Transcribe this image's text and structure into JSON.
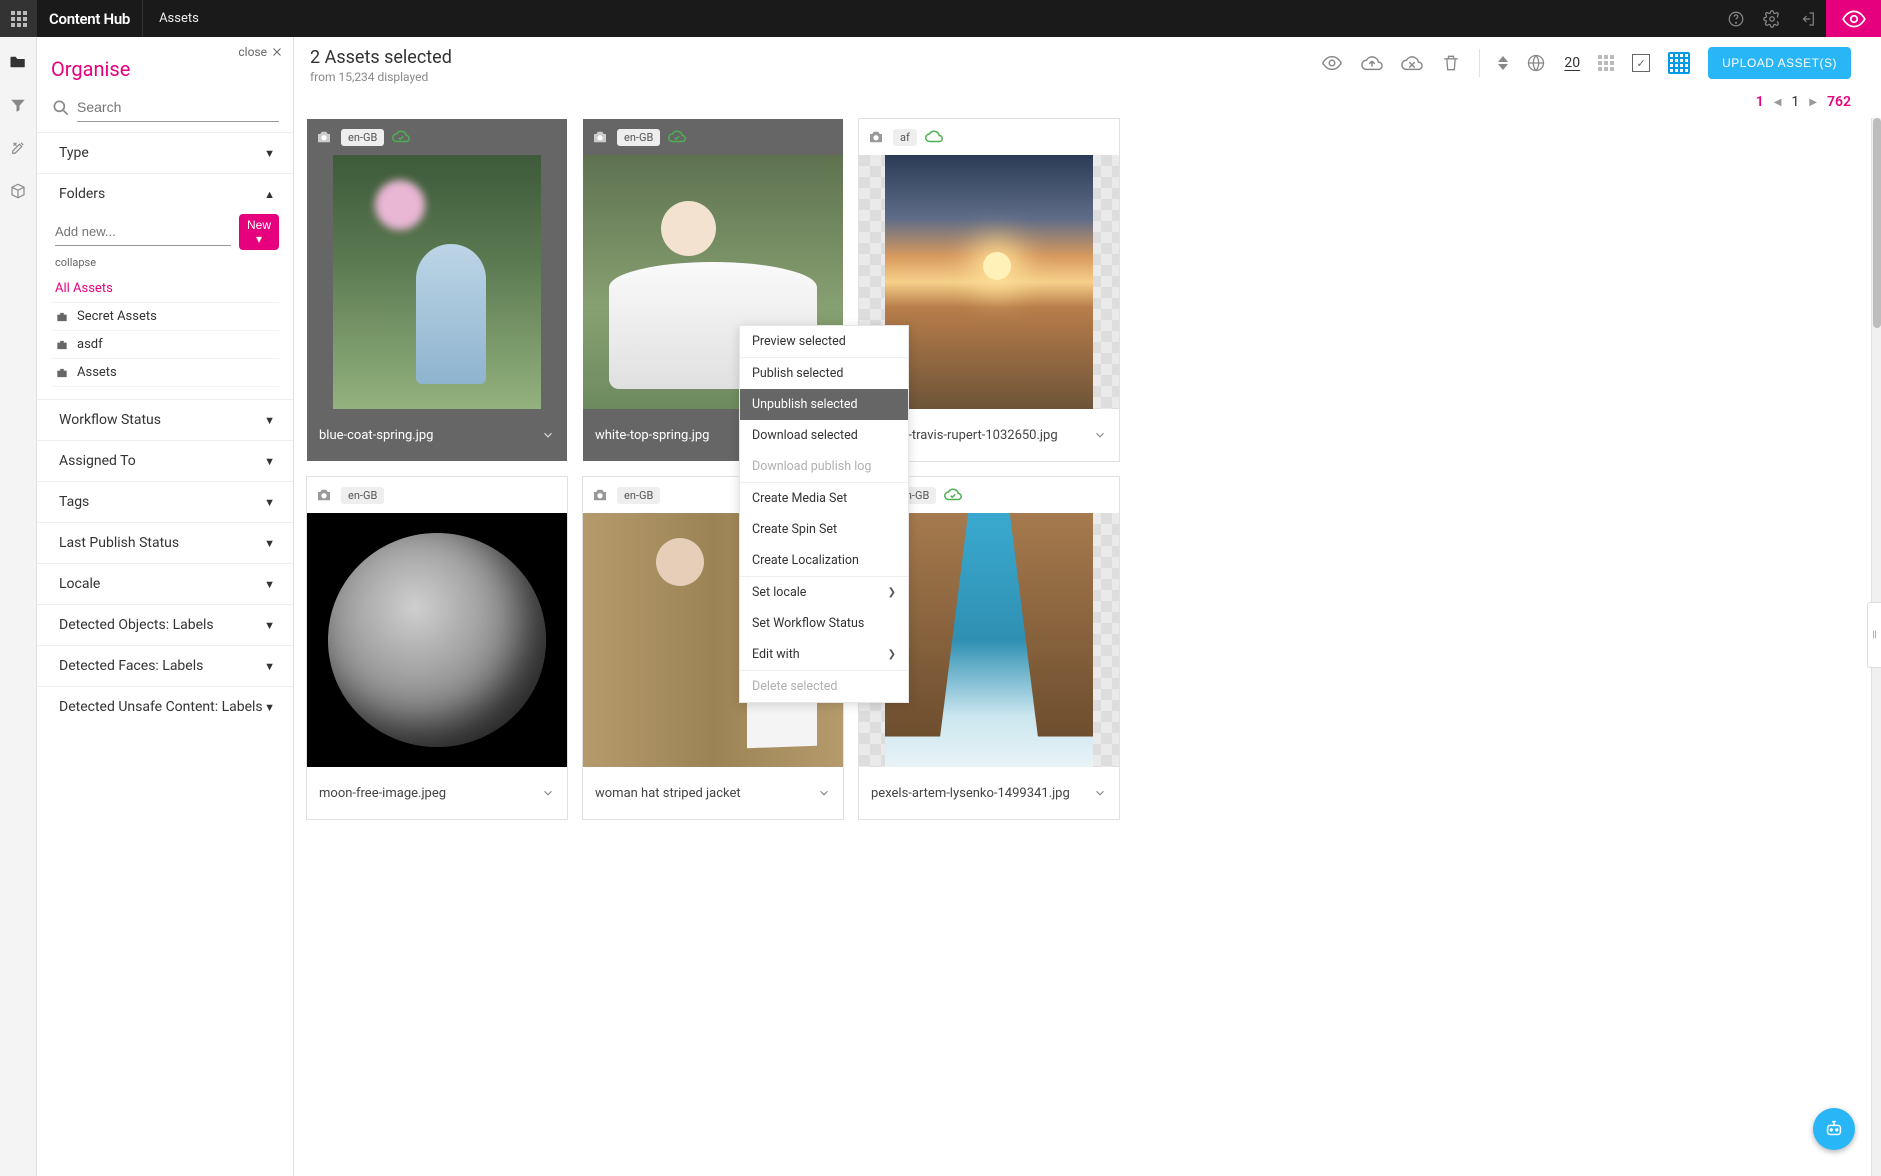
{
  "brand": "Content Hub",
  "top_nav": {
    "assets": "Assets"
  },
  "sidebar": {
    "close_label": "close",
    "title": "Organise",
    "search_placeholder": "Search",
    "sections": {
      "type": "Type",
      "folders": "Folders",
      "workflow_status": "Workflow Status",
      "assigned_to": "Assigned To",
      "tags": "Tags",
      "last_publish_status": "Last Publish Status",
      "locale": "Locale",
      "detected_objects": "Detected Objects: Labels",
      "detected_faces": "Detected Faces: Labels",
      "detected_unsafe": "Detected Unsafe Content: Labels"
    },
    "folders": {
      "add_placeholder": "Add new...",
      "new_btn": "New ▾",
      "collapse": "collapse",
      "items": [
        {
          "label": "All Assets",
          "all": true
        },
        {
          "label": "Secret Assets"
        },
        {
          "label": "asdf"
        },
        {
          "label": "Assets"
        }
      ]
    }
  },
  "content": {
    "selection_title": "2 Assets selected",
    "selection_sub": "from 15,234 displayed",
    "page_size": "20",
    "upload_btn": "UPLOAD ASSET(S)",
    "pagination": {
      "first": "1",
      "current": "1",
      "last": "762"
    }
  },
  "assets": [
    {
      "locale": "en-GB",
      "published": true,
      "selected": true,
      "full": false,
      "name": "blue-coat-spring.jpg",
      "paint": "p-bluecoat"
    },
    {
      "locale": "en-GB",
      "published": true,
      "selected": true,
      "full": true,
      "name": "white-top-spring.jpg",
      "paint": "p-whitetop"
    },
    {
      "locale": "af",
      "published": true,
      "selected": false,
      "full": false,
      "name": "pexels-travis-rupert-1032650.jpg",
      "paint": "p-sunset"
    },
    {
      "locale": "en-GB",
      "published": false,
      "selected": false,
      "full": true,
      "name": "moon-free-image.jpeg",
      "paint": "p-moon"
    },
    {
      "locale": "en-GB",
      "published": false,
      "selected": false,
      "full": true,
      "name": "woman hat striped jacket",
      "paint": "p-woman"
    },
    {
      "locale": "en-GB",
      "published": true,
      "selected": false,
      "full": false,
      "name": "pexels-artem-lysenko-1499341.jpg",
      "paint": "p-rocks"
    }
  ],
  "context_menu": [
    {
      "label": "Preview selected",
      "type": "item"
    },
    {
      "type": "sep"
    },
    {
      "label": "Publish selected",
      "type": "item"
    },
    {
      "label": "Unpublish selected",
      "type": "item",
      "hover": true
    },
    {
      "label": "Download selected",
      "type": "item"
    },
    {
      "label": "Download publish log",
      "type": "item",
      "disabled": true
    },
    {
      "type": "sep"
    },
    {
      "label": "Create Media Set",
      "type": "item"
    },
    {
      "label": "Create Spin Set",
      "type": "item"
    },
    {
      "label": "Create Localization",
      "type": "item"
    },
    {
      "type": "sep"
    },
    {
      "label": "Set locale",
      "type": "submenu"
    },
    {
      "label": "Set Workflow Status",
      "type": "item"
    },
    {
      "label": "Edit with",
      "type": "submenu"
    },
    {
      "type": "sep"
    },
    {
      "label": "Delete selected",
      "type": "item",
      "disabled": true
    }
  ]
}
